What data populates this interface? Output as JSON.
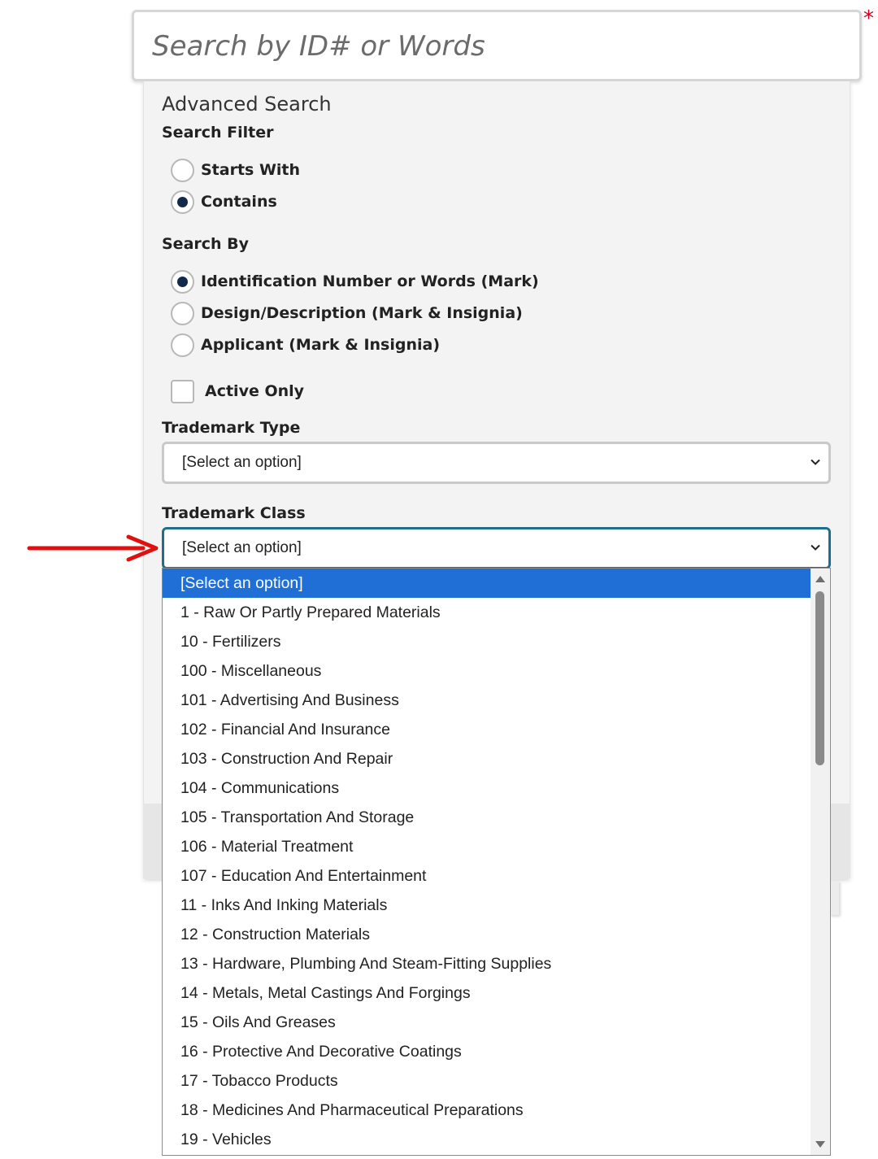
{
  "search": {
    "placeholder": "Search by ID# or Words",
    "required_marker": "*"
  },
  "advanced": {
    "title": "Advanced Search",
    "search_filter": {
      "label": "Search Filter",
      "options": [
        {
          "label": "Starts With",
          "checked": false
        },
        {
          "label": "Contains",
          "checked": true
        }
      ]
    },
    "search_by": {
      "label": "Search By",
      "options": [
        {
          "label": "Identification Number or Words (Mark)",
          "checked": true
        },
        {
          "label": "Design/Description (Mark & Insignia)",
          "checked": false
        },
        {
          "label": "Applicant (Mark & Insignia)",
          "checked": false
        }
      ]
    },
    "active_only": {
      "label": "Active Only",
      "checked": false
    },
    "trademark_type": {
      "label": "Trademark Type",
      "value": "[Select an option]"
    },
    "trademark_class": {
      "label": "Trademark Class",
      "value": "[Select an option]",
      "options": [
        "[Select an option]",
        "1 - Raw Or Partly Prepared Materials",
        "10 - Fertilizers",
        "100 - Miscellaneous",
        "101 - Advertising And Business",
        "102 - Financial And Insurance",
        "103 - Construction And Repair",
        "104 - Communications",
        "105 - Transportation And Storage",
        "106 - Material Treatment",
        "107 - Education And Entertainment",
        "11 - Inks And Inking Materials",
        "12 - Construction Materials",
        "13 - Hardware, Plumbing And Steam-Fitting Supplies",
        "14 - Metals, Metal Castings And Forgings",
        "15 - Oils And Greases",
        "16 - Protective And Decorative Coatings",
        "17 - Tobacco Products",
        "18 - Medicines And Pharmaceutical Preparations",
        "19 - Vehicles"
      ],
      "highlighted_index": 0
    }
  },
  "colors": {
    "highlight": "#1f6fd6",
    "focus_border": "#1f6e8c",
    "radio_dot": "#13294b",
    "annotation_arrow": "#e01010",
    "required": "#d0021b"
  }
}
